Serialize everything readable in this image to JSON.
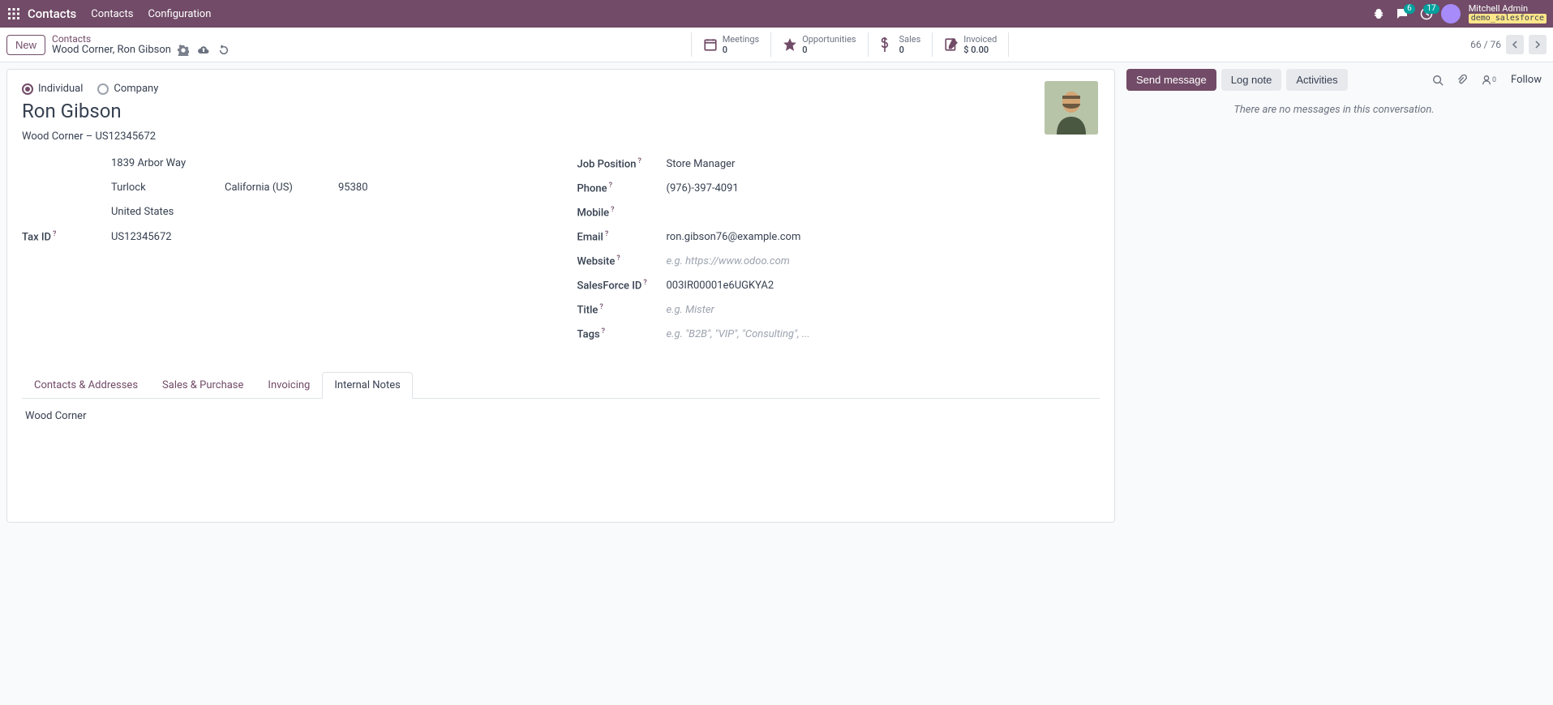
{
  "nav": {
    "brand": "Contacts",
    "menu": [
      "Contacts",
      "Configuration"
    ],
    "chat_badge": "6",
    "clock_badge": "17",
    "user_name": "Mitchell Admin",
    "db_name": "demo_salesforce"
  },
  "ctrl": {
    "new_label": "New",
    "bc_root": "Contacts",
    "bc_current": "Wood Corner, Ron Gibson",
    "stats": [
      {
        "icon": "calendar",
        "label": "Meetings",
        "value": "0"
      },
      {
        "icon": "star",
        "label": "Opportunities",
        "value": "0"
      },
      {
        "icon": "dollar",
        "label": "Sales",
        "value": "0"
      },
      {
        "icon": "edit",
        "label": "Invoiced",
        "value": "$ 0.00"
      }
    ],
    "pager_current": "66",
    "pager_sep": " / ",
    "pager_total": "76"
  },
  "form": {
    "radio_individual": "Individual",
    "radio_company": "Company",
    "name": "Ron Gibson",
    "company_line": "Wood Corner – US12345672",
    "address": {
      "street": "1839 Arbor Way",
      "city": "Turlock",
      "state": "California (US)",
      "zip": "95380",
      "country": "United States"
    },
    "tax_id_label": "Tax ID",
    "tax_id": "US12345672",
    "right_fields": {
      "job_position_label": "Job Position",
      "job_position": "Store Manager",
      "phone_label": "Phone",
      "phone": "(976)-397-4091",
      "mobile_label": "Mobile",
      "mobile": "",
      "email_label": "Email",
      "email": "ron.gibson76@example.com",
      "website_label": "Website",
      "website_placeholder": "e.g. https://www.odoo.com",
      "salesforce_label": "SalesForce ID",
      "salesforce": "003IR00001e6UGKYA2",
      "title_label": "Title",
      "title_placeholder": "e.g. Mister",
      "tags_label": "Tags",
      "tags_placeholder": "e.g. \"B2B\", \"VIP\", \"Consulting\", ..."
    },
    "tabs": [
      "Contacts & Addresses",
      "Sales & Purchase",
      "Invoicing",
      "Internal Notes"
    ],
    "active_tab": 3,
    "notes_content": "Wood Corner"
  },
  "chatter": {
    "send": "Send message",
    "lognote": "Log note",
    "activities": "Activities",
    "follower_count": "0",
    "follow": "Follow",
    "empty": "There are no messages in this conversation."
  }
}
